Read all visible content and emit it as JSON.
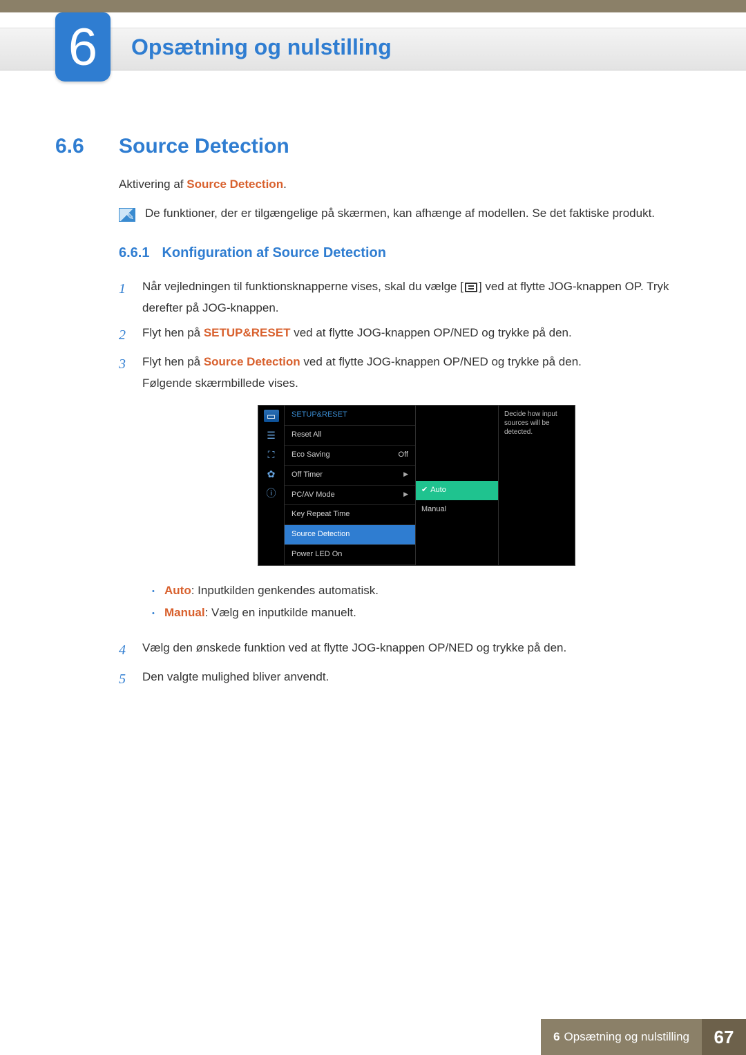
{
  "chapter": {
    "number": "6",
    "title": "Opsætning og nulstilling"
  },
  "section": {
    "number": "6.6",
    "title": "Source Detection"
  },
  "intro": {
    "prefix": "Aktivering af ",
    "keyword": "Source Detection",
    "suffix": "."
  },
  "note": "De funktioner, der er tilgængelige på skærmen, kan afhænge af modellen. Se det faktiske produkt.",
  "subsection": {
    "number": "6.6.1",
    "title": "Konfiguration af Source Detection"
  },
  "steps": {
    "s1": {
      "pre": "Når vejledningen til funktionsknapperne vises, skal du vælge [",
      "post": "] ved at flytte JOG-knappen OP. Tryk derefter på JOG-knappen."
    },
    "s2": {
      "pre": "Flyt hen på ",
      "kw": "SETUP&RESET",
      "post": " ved at flytte JOG-knappen OP/NED og trykke på den."
    },
    "s3": {
      "pre": "Flyt hen på ",
      "kw": "Source Detection",
      "post": " ved at flytte JOG-knappen OP/NED og trykke på den.",
      "extra": "Følgende skærmbillede vises."
    },
    "s4": "Vælg den ønskede funktion ved at flytte JOG-knappen OP/NED og trykke på den.",
    "s5": "Den valgte mulighed bliver anvendt."
  },
  "osd": {
    "header": "SETUP&RESET",
    "items": {
      "reset": "Reset All",
      "eco": "Eco Saving",
      "eco_val": "Off",
      "off_timer": "Off Timer",
      "pcav": "PC/AV Mode",
      "key_repeat": "Key Repeat Time",
      "source_det": "Source Detection",
      "power_led": "Power LED On"
    },
    "options": {
      "auto": "Auto",
      "manual": "Manual"
    },
    "desc": "Decide how input sources will be detected."
  },
  "bullets": {
    "auto": {
      "kw": "Auto",
      "text": ": Inputkilden genkendes automatisk."
    },
    "manual": {
      "kw": "Manual",
      "text": ": Vælg en inputkilde manuelt."
    }
  },
  "footer": {
    "chapter_prefix": "6",
    "label": "Opsætning og nulstilling",
    "page": "67"
  }
}
